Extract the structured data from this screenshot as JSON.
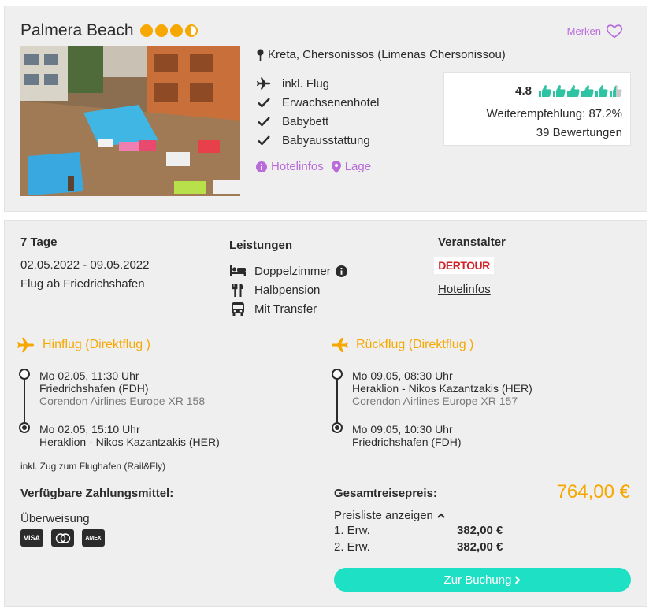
{
  "hotel": {
    "name": "Palmera Beach",
    "sun_rating": 3.5,
    "bookmark_label": "Merken",
    "location": "Kreta, Chersonissos (Limenas Chersonissou)",
    "features": [
      "inkl. Flug",
      "Erwachsenenhotel",
      "Babybett",
      "Babyausstattung"
    ],
    "links": {
      "hotelinfos": "Hotelinfos",
      "lage": "Lage"
    }
  },
  "rating": {
    "score": "4.8",
    "thumbs": 5.5,
    "recommendation": "Weiterempfehlung: 87.2%",
    "reviews": "39 Bewertungen"
  },
  "trip": {
    "duration": "7 Tage",
    "dates": "02.05.2022 - 09.05.2022",
    "departure": "Flug ab Friedrichshafen"
  },
  "services": {
    "title": "Leistungen",
    "items": [
      "Doppelzimmer",
      "Halbpension",
      "Mit Transfer"
    ]
  },
  "operator": {
    "title": "Veranstalter",
    "logo_text": "DERTOUR",
    "link": "Hotelinfos"
  },
  "outbound": {
    "title": "Hinflug (Direktflug )",
    "dep_time": "Mo 02.05, 11:30 Uhr",
    "dep_airport": "Friedrichshafen (FDH)",
    "airline": "Corendon Airlines Europe XR 158",
    "arr_time": "Mo 02.05, 15:10 Uhr",
    "arr_airport": "Heraklion - Nikos Kazantzakis (HER)"
  },
  "return": {
    "title": "Rückflug (Direktflug )",
    "dep_time": "Mo 09.05, 08:30 Uhr",
    "dep_airport": "Heraklion - Nikos Kazantzakis (HER)",
    "airline": "Corendon Airlines Europe XR 157",
    "arr_time": "Mo 09.05, 10:30 Uhr",
    "arr_airport": "Friedrichshafen (FDH)"
  },
  "rail_note": "inkl. Zug zum Flughafen (Rail&Fly)",
  "payment": {
    "title": "Verfügbare Zahlungsmittel:",
    "method": "Überweisung",
    "cards": [
      "VISA",
      "MC",
      "AMEX"
    ]
  },
  "price": {
    "title": "Gesamtreisepreis:",
    "total": "764,00 €",
    "list_toggle": "Preisliste anzeigen",
    "rows": [
      {
        "label": "1. Erw.",
        "amount": "382,00 €"
      },
      {
        "label": "2. Erw.",
        "amount": "382,00 €"
      }
    ]
  },
  "booking_button": "Zur Buchung",
  "colors": {
    "accent": "#f6a800",
    "purple": "#b86bd9",
    "teal": "#1ee0c5",
    "thumb": "#2ec4a3"
  }
}
